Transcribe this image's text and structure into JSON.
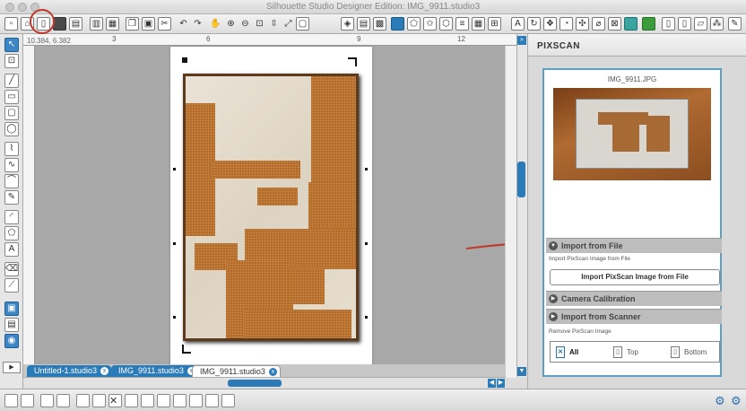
{
  "window": {
    "title": "Silhouette Studio Designer Edition: IMG_9911.studio3"
  },
  "ruler": {
    "coords": "10.384, 6.382",
    "labels": [
      "3",
      "6",
      "9",
      "12"
    ]
  },
  "tabs": [
    {
      "label": "Untitled-1.studio3",
      "close": "x"
    },
    {
      "label": "IMG_9911.studio3",
      "close": "x"
    },
    {
      "label": "IMG_9911.studio3",
      "close": "x",
      "active": true
    }
  ],
  "panel": {
    "title": "PIXSCAN",
    "preview_filename": "IMG_9911.JPG",
    "sections": {
      "import_file": "Import from File",
      "import_file_note": "Import PixScan Image from File",
      "import_button": "Import PixScan Image from File",
      "camera": "Camera Calibration",
      "scanner": "Import from Scanner",
      "remove_note": "Remove PixScan Image"
    },
    "remove": {
      "all": "All",
      "top": "Top",
      "bottom": "Bottom"
    }
  },
  "icons": {
    "toolbar": [
      "new-document-icon",
      "open-icon",
      "pixscan-icon",
      "save-icon",
      "print-icon",
      "cut-icon",
      "copy-icon",
      "paste-icon",
      "undo-icon",
      "redo-icon",
      "pan-icon",
      "zoom-in-icon",
      "zoom-out-icon",
      "zoom-fit-icon",
      "text-icon",
      "send-to-silhouette-icon"
    ],
    "accent": "#2b7bb9",
    "annotation": "#c0392b"
  }
}
